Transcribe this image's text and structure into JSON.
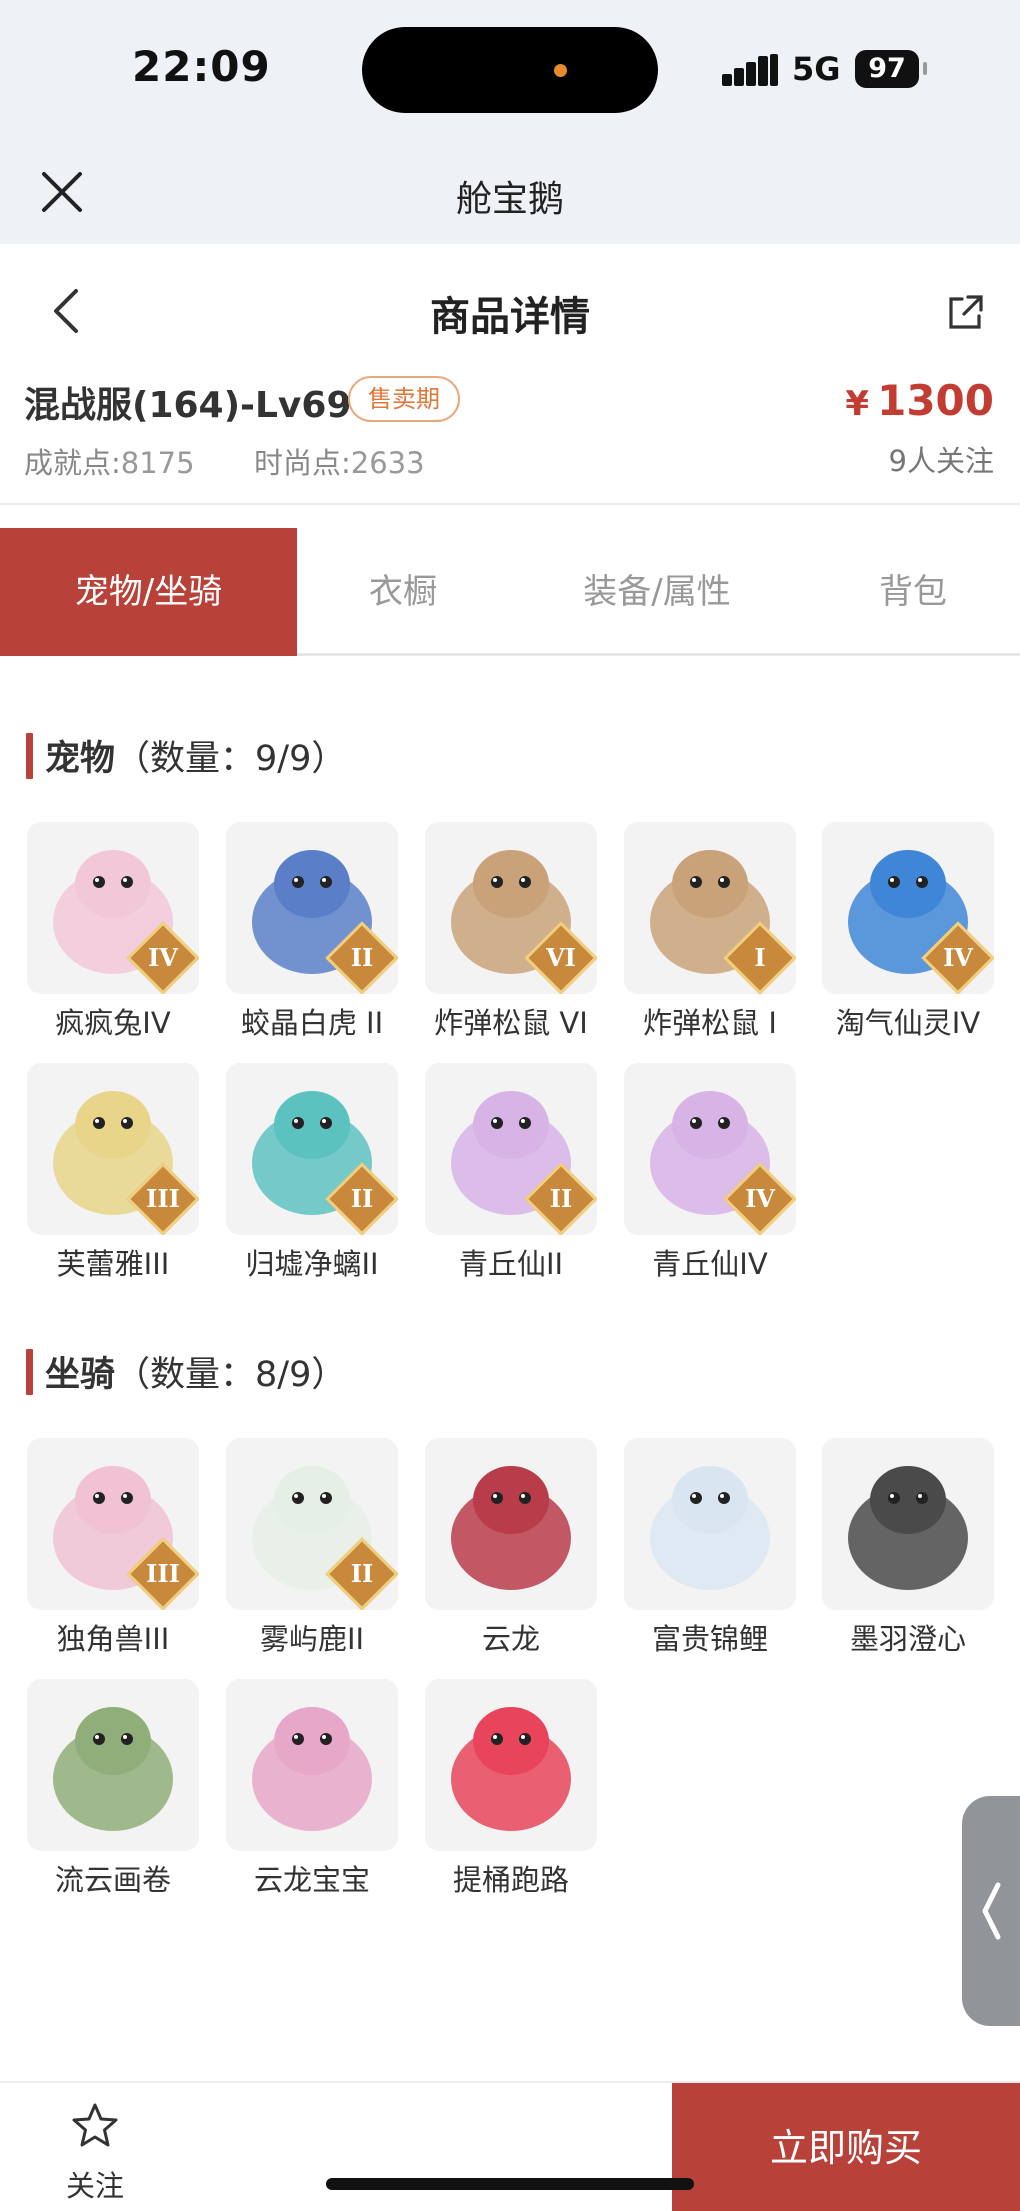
{
  "status": {
    "time": "22:09",
    "network": "5G",
    "battery": "97"
  },
  "miniprogram": {
    "title": "舱宝鹅"
  },
  "header": {
    "title": "商品详情"
  },
  "product": {
    "name": "混战服(164)-Lv69",
    "badge": "售卖期",
    "currency": "¥",
    "price": "1300",
    "achievement_label": "成就点:",
    "achievement_value": "8175",
    "fashion_label": "时尚点:",
    "fashion_value": "2633",
    "followers": "9人关注"
  },
  "tabs": [
    {
      "label": "宠物/坐骑",
      "active": true
    },
    {
      "label": "衣橱",
      "active": false
    },
    {
      "label": "装备/属性",
      "active": false
    },
    {
      "label": "背包",
      "active": false
    }
  ],
  "pets": {
    "title": "宠物",
    "count_label": "（数量：9/9）",
    "items": [
      {
        "name": "疯疯兔IV",
        "grade": "IV",
        "icon": "rabbit-pet-icon",
        "color": "#f2c8d8"
      },
      {
        "name": "蛟晶白虎 II",
        "grade": "II",
        "icon": "white-tiger-pet-icon",
        "color": "#5a7fc8"
      },
      {
        "name": "炸弹松鼠 VI",
        "grade": "VI",
        "icon": "squirrel-pet-icon",
        "color": "#c9a27a"
      },
      {
        "name": "炸弹松鼠 I",
        "grade": "I",
        "icon": "squirrel-pet-icon",
        "color": "#c9a27a"
      },
      {
        "name": "淘气仙灵IV",
        "grade": "IV",
        "icon": "blue-pup-pet-icon",
        "color": "#3f86d6"
      },
      {
        "name": "芙蕾雅III",
        "grade": "III",
        "icon": "goddess-pet-icon",
        "color": "#e8d58a"
      },
      {
        "name": "归墟净螭II",
        "grade": "II",
        "icon": "teal-dragon-pet-icon",
        "color": "#5cc2c0"
      },
      {
        "name": "青丘仙II",
        "grade": "II",
        "icon": "fox-fairy-pet-icon",
        "color": "#d7b3e6"
      },
      {
        "name": "青丘仙IV",
        "grade": "IV",
        "icon": "fox-fairy-pet-icon",
        "color": "#d7b3e6"
      }
    ]
  },
  "mounts": {
    "title": "坐骑",
    "count_label": "（数量：8/9）",
    "items": [
      {
        "name": "独角兽III",
        "grade": "III",
        "icon": "unicorn-mount-icon",
        "color": "#f0c2d4"
      },
      {
        "name": "雾屿鹿II",
        "grade": "II",
        "icon": "deer-mount-icon",
        "color": "#e6efe6"
      },
      {
        "name": "云龙",
        "grade": "",
        "icon": "cloud-dragon-mount-icon",
        "color": "#b83c4a"
      },
      {
        "name": "富贵锦鲤",
        "grade": "",
        "icon": "koi-mount-icon",
        "color": "#d9e6f2"
      },
      {
        "name": "墨羽澄心",
        "grade": "",
        "icon": "ink-feather-mount-icon",
        "color": "#4a4a4a"
      },
      {
        "name": "流云画卷",
        "grade": "",
        "icon": "bamboo-scroll-mount-icon",
        "color": "#8fae7a"
      },
      {
        "name": "云龙宝宝",
        "grade": "",
        "icon": "baby-dragon-mount-icon",
        "color": "#e6a7c8"
      },
      {
        "name": "提桶跑路",
        "grade": "",
        "icon": "bucket-mount-icon",
        "color": "#e8455c"
      }
    ]
  },
  "bottom": {
    "follow_label": "关注",
    "buy_label": "立即购买"
  }
}
